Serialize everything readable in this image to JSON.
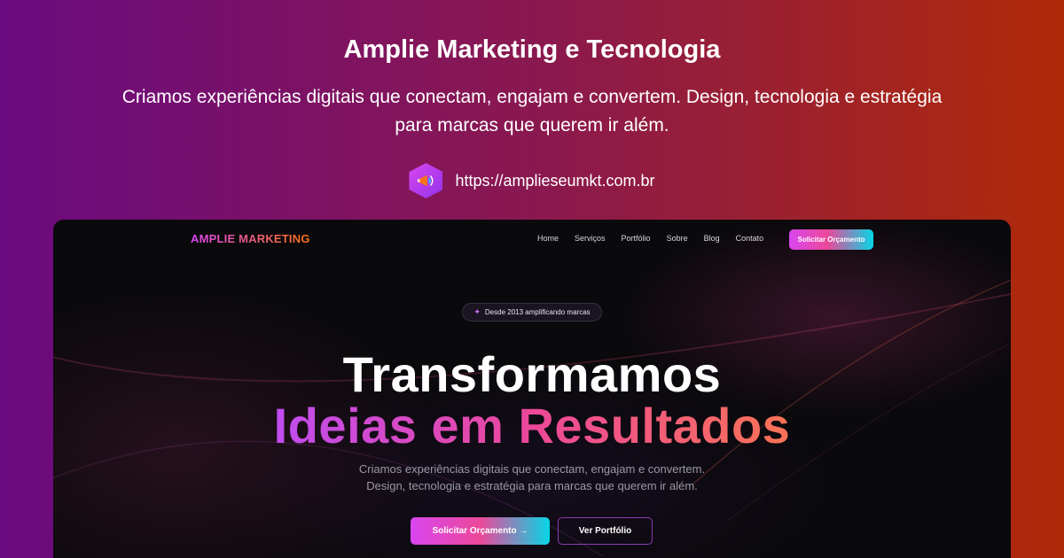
{
  "og": {
    "title": "Amplie Marketing e Tecnologia",
    "subtitle": "Criamos experiências digitais que conectam, engajam e convertem. Design, tecnologia e estratégia para marcas que querem ir além.",
    "url": "https://amplieseumkt.com.br",
    "logo_icon": "megaphone-icon"
  },
  "site": {
    "brand": "AMPLIE MARKETING",
    "nav": [
      "Home",
      "Serviços",
      "Portfólio",
      "Sobre",
      "Blog",
      "Contato"
    ],
    "nav_cta": "Solicitar Orçamento",
    "badge": {
      "icon": "sparkles-icon",
      "text": "Desde 2013 amplificando marcas"
    },
    "hero_line1": "Transformamos",
    "hero_line2": "Ideias em Resultados",
    "hero_description_1": "Criamos experiências digitais que conectam, engajam e convertem.",
    "hero_description_2": "Design, tecnologia e estratégia para marcas que querem ir além.",
    "primary_button": "Solicitar Orçamento →",
    "secondary_button": "Ver Portfólio"
  },
  "colors": {
    "accent_magenta": "#d946ef",
    "accent_pink": "#ec4899",
    "accent_cyan": "#06d6e6",
    "accent_orange": "#f97316",
    "dark_bg": "#0a090c"
  }
}
